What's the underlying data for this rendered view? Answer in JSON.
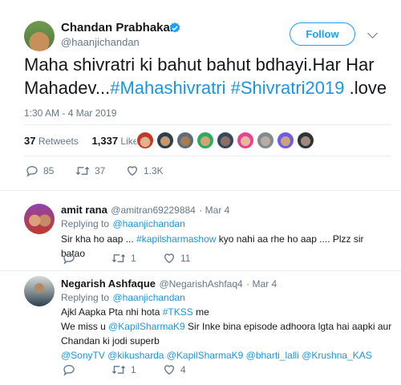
{
  "main_tweet": {
    "author_name": "Chandan Prabhakar",
    "author_handle": "@haanjichandan",
    "follow_label": "Follow",
    "text_plain_1": "Maha shivratri ki bahut bahut bdhayi.Har Har Mahadev...",
    "hashtag_1": "#Mahashivratri",
    "hashtag_2": "#Shivratri2019",
    "text_plain_2": " .love",
    "timestamp": "1:30 AM - 4 Mar 2019",
    "retweets_count": "37",
    "retweets_label": "Retweets",
    "likes_count": "1,337",
    "likes_label": "Likes",
    "reply_count": "85",
    "retweet_action_count": "37",
    "like_action_count": "1.3K"
  },
  "replies": [
    {
      "author_name": "amit rana",
      "author_handle": "@amitran69229884",
      "date": "· Mar 4",
      "replying_to_label": "Replying to",
      "replying_to_handle": "@haanjichandan",
      "body_pre": "Sir kha ho aap ... ",
      "body_tag": "#kapilsharmashow",
      "body_post": " kyo nahi aa rhe ho aap .... Plzz sir batao",
      "retweet_count": "1",
      "like_count": "11"
    },
    {
      "author_name": "Negarish Ashfaque",
      "author_handle": "@NegarishAshfaq4",
      "date": "· Mar 4",
      "replying_to_label": "Replying to",
      "replying_to_handle": "@haanjichandan",
      "line1_pre": "Ajkl Aapka Pta nhi hota ",
      "line1_tag": "#TKSS",
      "line1_post": " me",
      "line2_pre": "We miss u ",
      "line2_mention": "@KapilSharmaK9",
      "line2_post": "  Sir Inke bina episode adhoora lgta hai aapki aur",
      "line3": "Chandan ki jodi superb",
      "line4_mentions": "@SonyTV @kikusharda @KapilSharmaK9 @bharti_lalli @Krushna_KAS",
      "retweet_count": "1",
      "like_count": "4"
    }
  ],
  "colors": {
    "link_blue": "#1b95e0",
    "follow_blue": "#1da1f2",
    "verified_blue": "#1da1f2",
    "muted_grey": "#657786",
    "divider": "#e6ecf0"
  },
  "icons": [
    "verified-badge-icon",
    "chevron-down-icon",
    "reply-icon",
    "retweet-icon",
    "like-icon"
  ]
}
